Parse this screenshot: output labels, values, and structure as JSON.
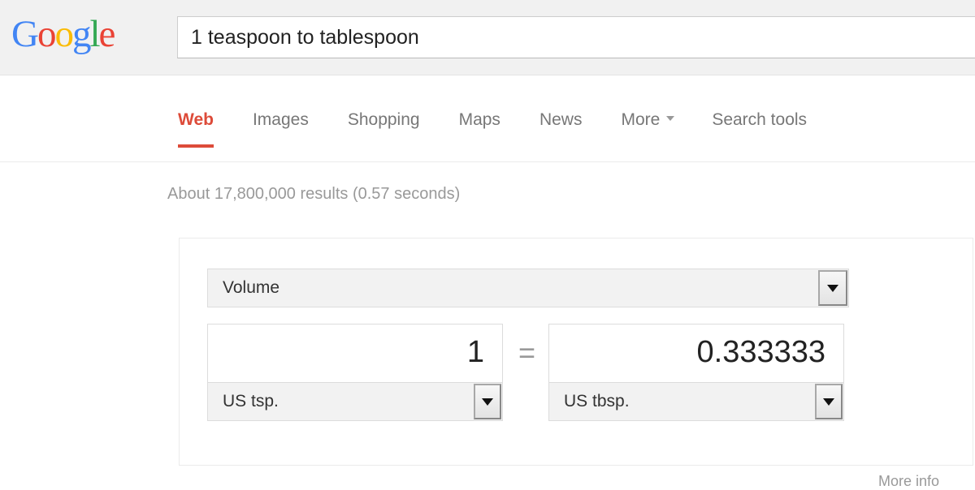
{
  "header": {
    "logo_text": "Google",
    "logo_letters": [
      {
        "ch": "G",
        "color": "#4285f4"
      },
      {
        "ch": "o",
        "color": "#ea4335"
      },
      {
        "ch": "o",
        "color": "#fbbc05"
      },
      {
        "ch": "g",
        "color": "#4285f4"
      },
      {
        "ch": "l",
        "color": "#34a853"
      },
      {
        "ch": "e",
        "color": "#ea4335"
      }
    ]
  },
  "search": {
    "query": "1 teaspoon to tablespoon",
    "placeholder": "Search"
  },
  "nav": {
    "tabs": [
      {
        "label": "Web",
        "active": true
      },
      {
        "label": "Images",
        "active": false
      },
      {
        "label": "Shopping",
        "active": false
      },
      {
        "label": "Maps",
        "active": false
      },
      {
        "label": "News",
        "active": false
      },
      {
        "label": "More",
        "active": false
      },
      {
        "label": "Search tools",
        "active": false
      }
    ],
    "active_color": "#dd4b39"
  },
  "results": {
    "stats": "About 17,800,000 results (0.57 seconds)"
  },
  "converter": {
    "unit_type": "Volume",
    "equals": "=",
    "left": {
      "value": "1",
      "unit": "US tsp."
    },
    "right": {
      "value": "0.333333",
      "unit": "US tbsp."
    },
    "more_info": "More info"
  }
}
